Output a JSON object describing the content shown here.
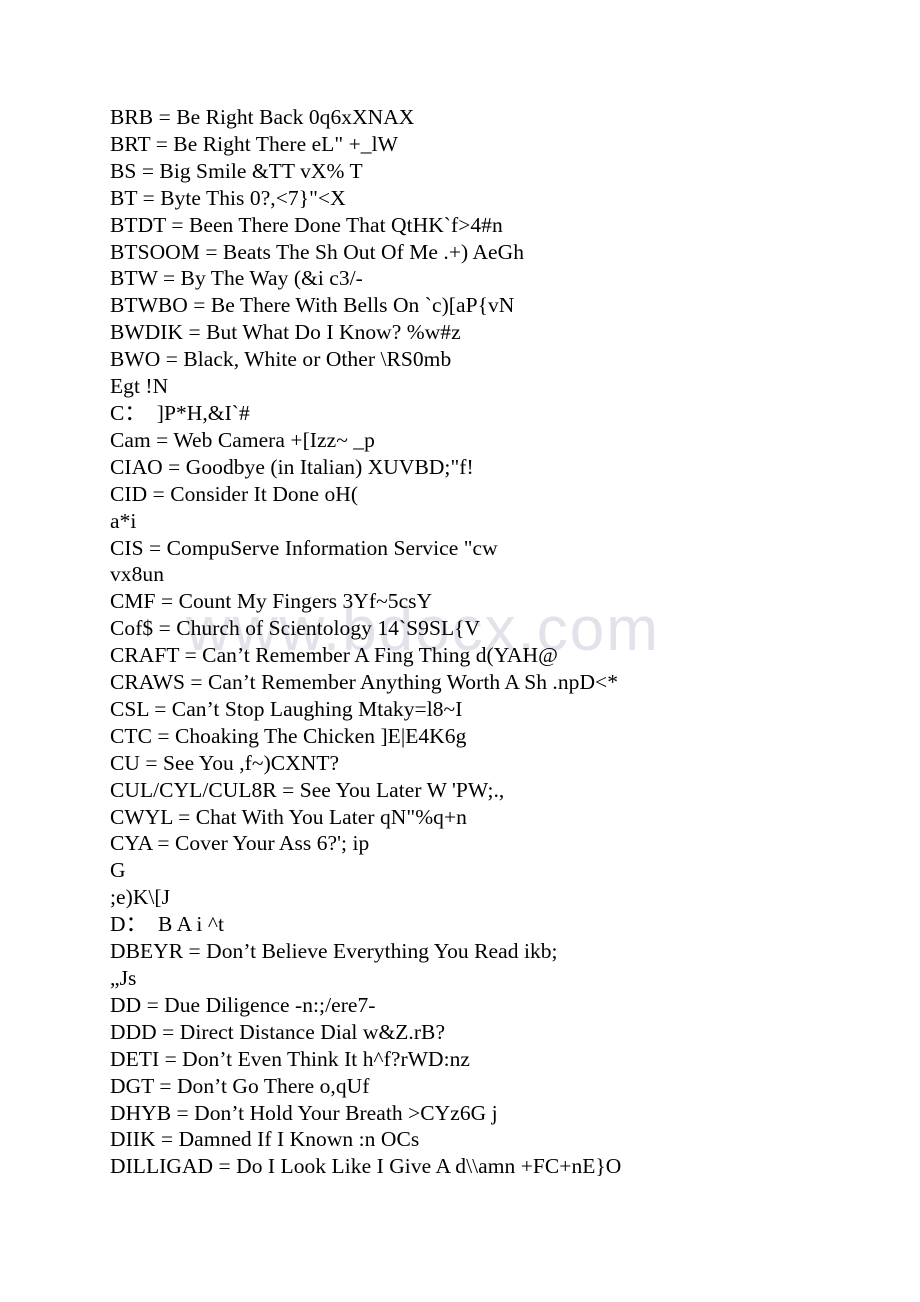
{
  "document": {
    "page_background": "#ffffff",
    "text_color": "#000000",
    "watermark": {
      "text": "www.bdocx.com",
      "color": "#e2e2ea"
    },
    "lines": [
      "BRB = Be Right Back 0q6xXNAX",
      "BRT = Be Right There eL\" +_lW",
      "BS = Big Smile &TT vX% T",
      "BT = Byte This 0?,<7}\"<X",
      "BTDT = Been There Done That QtHK`f>4#n",
      "BTSOOM = Beats The Sh Out Of Me .+) AeGh",
      "BTW = By The Way (&i c3/-",
      "BTWBO = Be There With Bells On `c)[aP{vN",
      "BWDIK = But What Do I Know? %w#z",
      "BWO = Black, White or Other \\RS0mb",
      "Egt !N",
      "C：  ]P*H,&I`#",
      "Cam = Web Camera +[Izz~ _p",
      "CIAO = Goodbye (in Italian) XUVBD;\"f!",
      "CID = Consider It Done oH(",
      "a*i",
      "CIS = CompuServe Information Service \"cw",
      "vx8un",
      "CMF = Count My Fingers 3Yf~5csY",
      "Cof$ = Church of Scientology 14`S9SL{V",
      "CRAFT = Can’t Remember A Fing Thing d(YAH@",
      "CRAWS = Can’t Remember Anything Worth A Sh .npD<*",
      "CSL = Can’t Stop Laughing Mtaky=l8~I",
      "CTC = Choaking The Chicken ]E|E4K6g",
      "CU = See You ,f~)CXNT?",
      "CUL/CYL/CUL8R = See You Later W 'PW;.,",
      "CWYL = Chat With You Later qN\"%q+n",
      "CYA = Cover Your Ass 6?'; ip",
      "G",
      ";e)K\\[J",
      "D：  B A i ^t",
      "DBEYR = Don’t Believe Everything You Read ikb;",
      "„Js",
      "DD = Due Diligence -n:;/ere7-",
      "DDD = Direct Distance Dial w&Z.rB?",
      "DETI = Don’t Even Think It h^f?rWD:nz",
      "DGT = Don’t Go There o,qUf",
      "DHYB = Don’t Hold Your Breath >CYz6G j",
      "DIIK = Damned If I Known :n OCs",
      "DILLIGAD = Do I Look Like I Give A d\\\\amn +FC+nE}O"
    ]
  }
}
